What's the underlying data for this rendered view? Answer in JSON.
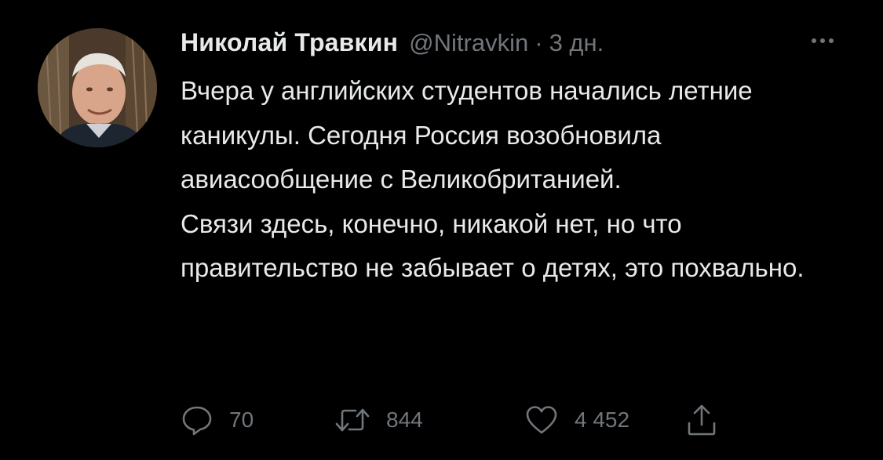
{
  "author": {
    "name": "Николай Травкин",
    "handle": "@Nitravkin",
    "separator": "·",
    "timestamp": "3 дн."
  },
  "tweet": {
    "paragraphs": [
      "Вчера у английских студентов начались летние каникулы. Сегодня Россия возобновила авиасообщение с Великобританией.",
      "Связи здесь, конечно, никакой нет, но что правительство не забывает о детях, это похвально."
    ]
  },
  "actions": {
    "reply_count": "70",
    "retweet_count": "844",
    "like_count": "4 452"
  },
  "icons": {
    "reply": "speech-bubble-icon",
    "retweet": "retweet-arrows-icon",
    "like": "heart-icon",
    "share": "share-upload-icon",
    "more": "ellipsis-icon"
  },
  "colors": {
    "background": "#000000",
    "text_primary": "#e7e9ea",
    "text_secondary": "#71767b"
  }
}
